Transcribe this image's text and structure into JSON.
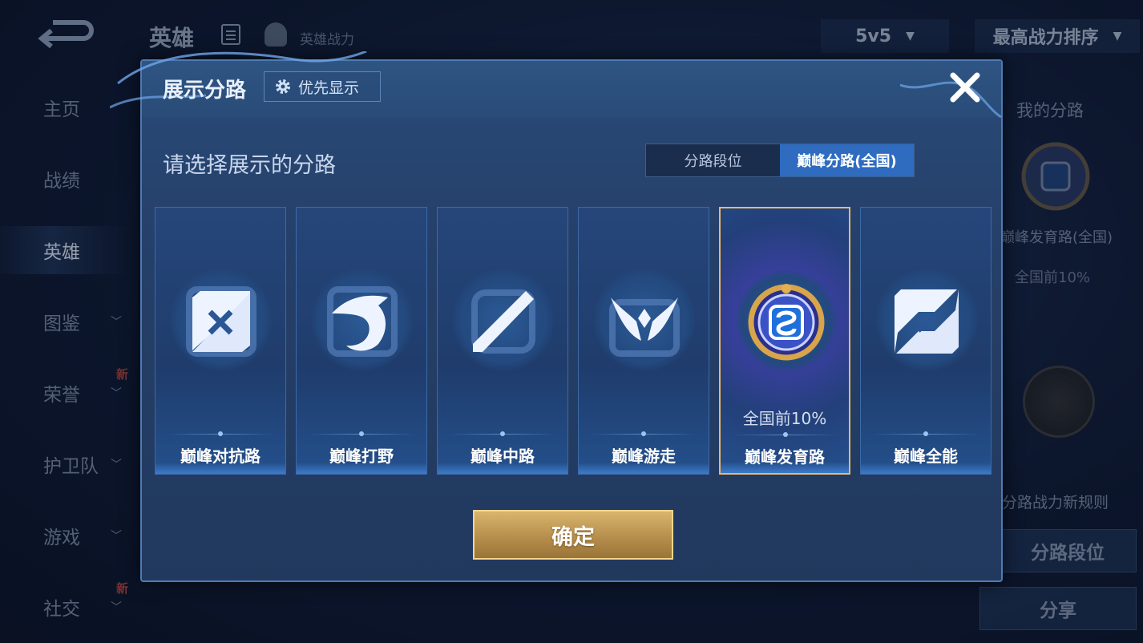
{
  "background": {
    "title": "英雄",
    "power_label": "英雄战力",
    "mode_dropdown": "5v5",
    "sort_dropdown": "最高战力排序",
    "sidebar": [
      {
        "label": "主页",
        "active": false
      },
      {
        "label": "战绩",
        "active": false
      },
      {
        "label": "英雄",
        "active": true
      },
      {
        "label": "图鉴",
        "active": false,
        "chevron": true
      },
      {
        "label": "荣誉",
        "active": false,
        "chevron": true,
        "badge": "新"
      },
      {
        "label": "护卫队",
        "active": false,
        "chevron": true
      },
      {
        "label": "游戏",
        "active": false,
        "chevron": true
      },
      {
        "label": "社交",
        "active": false,
        "chevron": true,
        "badge": "新"
      }
    ],
    "right_panel": {
      "title": "我的分路",
      "badge_label": "巅峰发育路(全国)",
      "rank": "全国前10%",
      "rule_text": "分路战力新规则",
      "lane_button": "分路段位",
      "share_button": "分享"
    }
  },
  "modal": {
    "title": "展示分路",
    "priority_button": "优先显示",
    "subtitle": "请选择展示的分路",
    "tabs": [
      {
        "label": "分路段位",
        "active": false
      },
      {
        "label": "巅峰分路(全国)",
        "active": true
      }
    ],
    "cards": [
      {
        "name": "巅峰对抗路",
        "icon": "clash-lane-icon",
        "rank": "",
        "selected": false
      },
      {
        "name": "巅峰打野",
        "icon": "jungle-dragon-icon",
        "rank": "",
        "selected": false
      },
      {
        "name": "巅峰中路",
        "icon": "mid-lane-icon",
        "rank": "",
        "selected": false
      },
      {
        "name": "巅峰游走",
        "icon": "roam-wings-icon",
        "rank": "",
        "selected": false
      },
      {
        "name": "巅峰发育路",
        "icon": "farm-lane-emblem-icon",
        "rank": "全国前10%",
        "selected": true
      },
      {
        "name": "巅峰全能",
        "icon": "all-round-icon",
        "rank": "",
        "selected": false
      }
    ],
    "confirm_button": "确定"
  },
  "colors": {
    "selected_border": "#e8b86a",
    "active_tab": "#2f6bbf",
    "confirm_gold": "#c9a25c",
    "modal_border": "#4f7bb3"
  }
}
